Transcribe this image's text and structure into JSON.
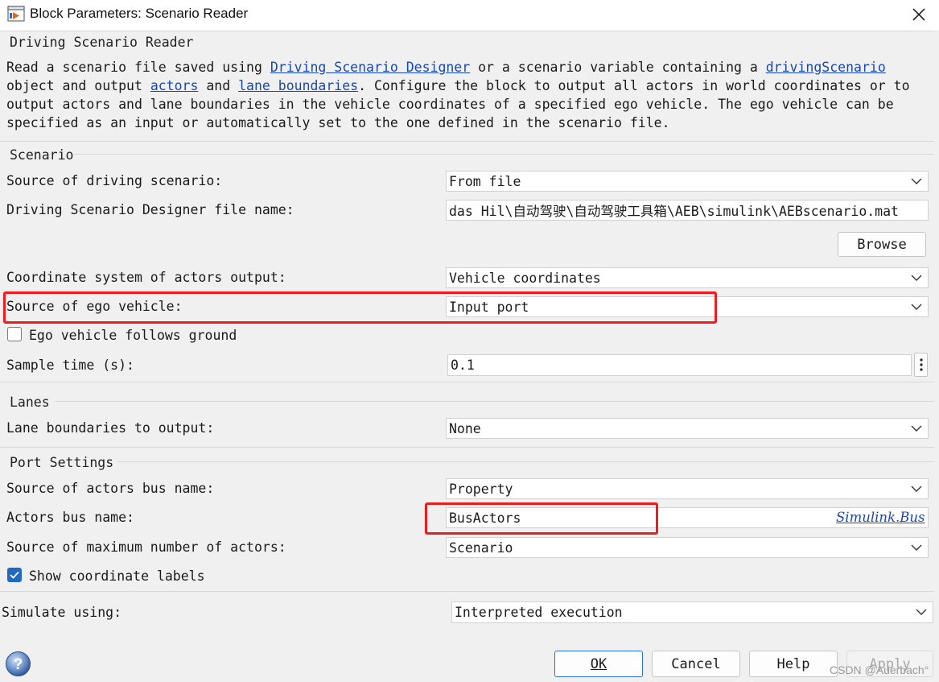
{
  "window": {
    "title": "Block Parameters: Scenario Reader"
  },
  "header": {
    "title": "Driving Scenario Reader",
    "desc_1": "Read a scenario file saved using ",
    "link_designer": "Driving Scenario Designer",
    "desc_2": " or a scenario variable containing a ",
    "link_driving_scenario": "drivingScenario",
    "desc_3": " object and output ",
    "link_actors": "actors",
    "desc_4": " and ",
    "link_lane_boundaries": "lane boundaries",
    "desc_5": ". Configure the block to output all actors in world coordinates or to output actors and lane boundaries in the vehicle coordinates of a specified ego vehicle. The ego vehicle can be specified as an input or automatically set to the one defined in the scenario file."
  },
  "scenario": {
    "title": "Scenario",
    "source_label": "Source of driving scenario:",
    "source_value": "From file",
    "file_label": "Driving Scenario Designer file name:",
    "file_value": "das Hil\\自动驾驶\\自动驾驶工具箱\\AEB\\simulink\\AEBscenario.mat",
    "browse_label": "Browse",
    "coord_label": "Coordinate system of actors output:",
    "coord_value": "Vehicle coordinates",
    "ego_label": "Source of ego vehicle:",
    "ego_value": "Input port",
    "follows_ground_label": "Ego vehicle follows ground",
    "follows_ground_checked": false,
    "sample_time_label": "Sample time (s):",
    "sample_time_value": "0.1"
  },
  "lanes": {
    "title": "Lanes",
    "lane_label": "Lane boundaries to output:",
    "lane_value": "None"
  },
  "port": {
    "title": "Port Settings",
    "bus_source_label": "Source of actors bus name:",
    "bus_source_value": "Property",
    "bus_name_label": "Actors bus name:",
    "bus_name_value": "BusActors",
    "bus_link": "Simulink.Bus",
    "max_actors_label": "Source of maximum number of actors:",
    "max_actors_value": "Scenario",
    "show_labels_label": "Show coordinate labels",
    "show_labels_checked": true
  },
  "simulate": {
    "label": "Simulate using:",
    "value": "Interpreted execution"
  },
  "footer": {
    "ok": "OK",
    "cancel": "Cancel",
    "help": "Help",
    "apply": "Apply",
    "watermark": "CSDN @Auerbach°"
  },
  "colors": {
    "accent": "#1f68c4",
    "link": "#1747b8",
    "highlight": "#ee1c1c"
  }
}
